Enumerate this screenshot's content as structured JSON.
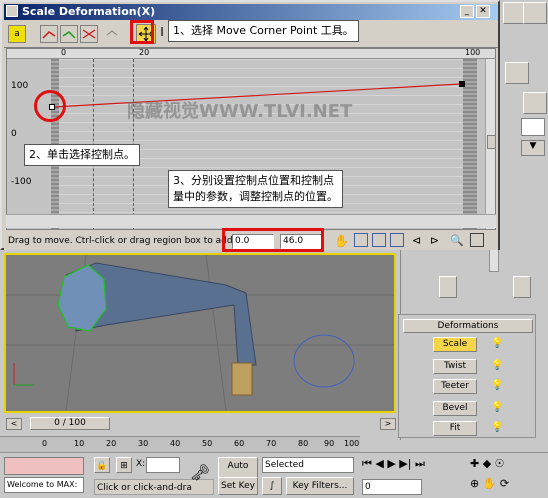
{
  "window": {
    "title": "Scale Deformation(X)"
  },
  "ruler": {
    "ticks": [
      "0",
      "20",
      "100"
    ]
  },
  "axis": {
    "labels": [
      "100",
      "0",
      "-100"
    ]
  },
  "status": {
    "hint": "Drag to move. Ctrl-click or drag region box to add to",
    "field1": "0.0",
    "field2": "46.0"
  },
  "callouts": {
    "step1": "1、选择 Move Corner Point 工具。",
    "step2": "2、单击选择控制点。",
    "step3_line1": "3、分别设置控制点位置和控制点",
    "step3_line2": "量中的参数，调整控制点的位置。"
  },
  "watermark": "隐藏视觉WWW.TLVI.NET",
  "deformations": {
    "header": "Deformations",
    "items": [
      {
        "label": "Scale"
      },
      {
        "label": "Twist"
      },
      {
        "label": "Teeter"
      },
      {
        "label": "Bevel"
      },
      {
        "label": "Fit"
      }
    ]
  },
  "timeline": {
    "slider": "0 / 100",
    "ticks": [
      "0",
      "10",
      "20",
      "30",
      "40",
      "50",
      "60",
      "70",
      "80",
      "90",
      "100"
    ]
  },
  "bottom": {
    "welcome": "Welcome to MAX:",
    "prompt": "Click or click-and-dra",
    "x_label": "X:",
    "auto_key": "Auto Key",
    "selected": "Selected",
    "set_key": "Set Key",
    "key_filters": "Key Filters...",
    "frame": "0"
  },
  "colors": {
    "highlight": "#e01010",
    "curve": "#d01818",
    "selected_btn": "#f5d64a"
  }
}
